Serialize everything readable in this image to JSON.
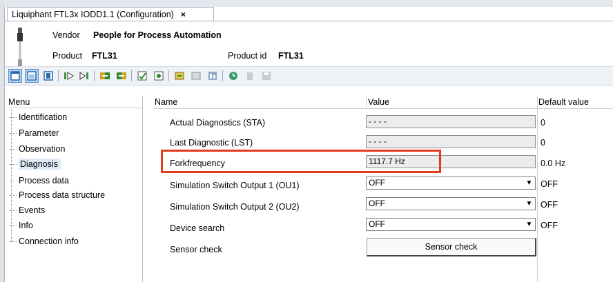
{
  "window": {
    "tab_title": "Liquiphant FTL3x IODD1.1 (Configuration)",
    "close_glyph": "×"
  },
  "header": {
    "vendor_label": "Vendor",
    "vendor_value": "People for Process Automation",
    "product_label": "Product",
    "product_value": "FTL31",
    "product_id_label": "Product id",
    "product_id_value": "FTL31"
  },
  "toolbar": {
    "icons": [
      "layout-tree-icon",
      "layout-full-icon",
      "layout-side-icon",
      "go-online-icon",
      "go-offline-icon",
      "upload-icon",
      "download-icon",
      "verify-icon",
      "compare-icon",
      "import-icon",
      "export-icon",
      "print-icon",
      "refresh-icon",
      "delete-icon",
      "save-icon"
    ]
  },
  "menu": {
    "header": "Menu",
    "items": [
      "Identification",
      "Parameter",
      "Observation",
      "Diagnosis",
      "Process data",
      "Process data structure",
      "Events",
      "Info",
      "Connection info"
    ],
    "selected": "Diagnosis"
  },
  "grid": {
    "columns": {
      "name": "Name",
      "value": "Value",
      "default": "Default value"
    },
    "rows": [
      {
        "name": "Actual Diagnostics (STA)",
        "value": "- - - -",
        "default": "0"
      },
      {
        "name": "Last Diagnostic (LST)",
        "value": "- - - -",
        "default": "0"
      },
      {
        "name": "Forkfrequency",
        "value": "1117.7 Hz",
        "default": "0.0 Hz"
      },
      {
        "name": "Simulation Switch Output 1 (OU1)",
        "value": "OFF",
        "default": "OFF"
      },
      {
        "name": "Simulation Switch Output 2 (OU2)",
        "value": "OFF",
        "default": "OFF"
      },
      {
        "name": "Device search",
        "value": "OFF",
        "default": "OFF"
      },
      {
        "name": "Sensor check",
        "button": "Sensor check"
      }
    ]
  },
  "colors": {
    "highlight": "#e23a1e",
    "selection": "#dde9f6",
    "toolbar_active": "#b7d3ee"
  }
}
